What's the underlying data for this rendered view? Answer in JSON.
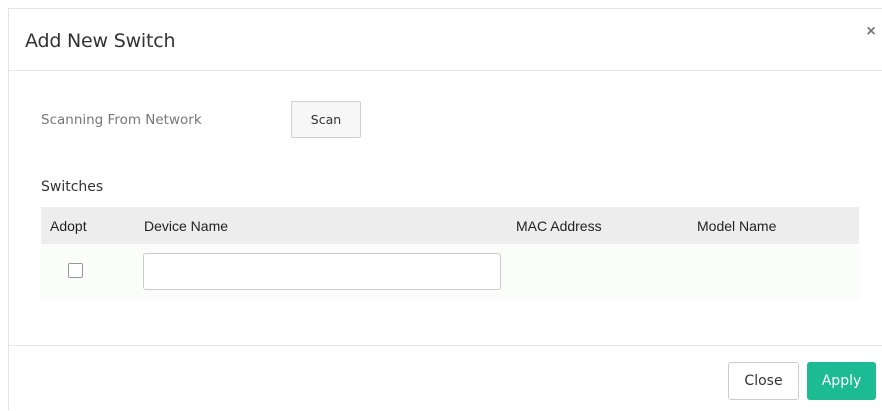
{
  "dialog": {
    "title": "Add New Switch",
    "close_glyph": "×",
    "close_icon": "close-icon"
  },
  "scan": {
    "label": "Scanning From Network",
    "button_label": "Scan"
  },
  "switches": {
    "section_label": "Switches",
    "columns": [
      "Adopt",
      "Device Name",
      "MAC Address",
      "Model Name"
    ],
    "rows": [
      {
        "adopt": false,
        "device_name": "",
        "mac_address": "",
        "model_name": ""
      }
    ]
  },
  "footer": {
    "close_label": "Close",
    "apply_label": "Apply"
  },
  "colors": {
    "apply_button": "#1dbb94",
    "table_header_bg": "#ededed"
  }
}
